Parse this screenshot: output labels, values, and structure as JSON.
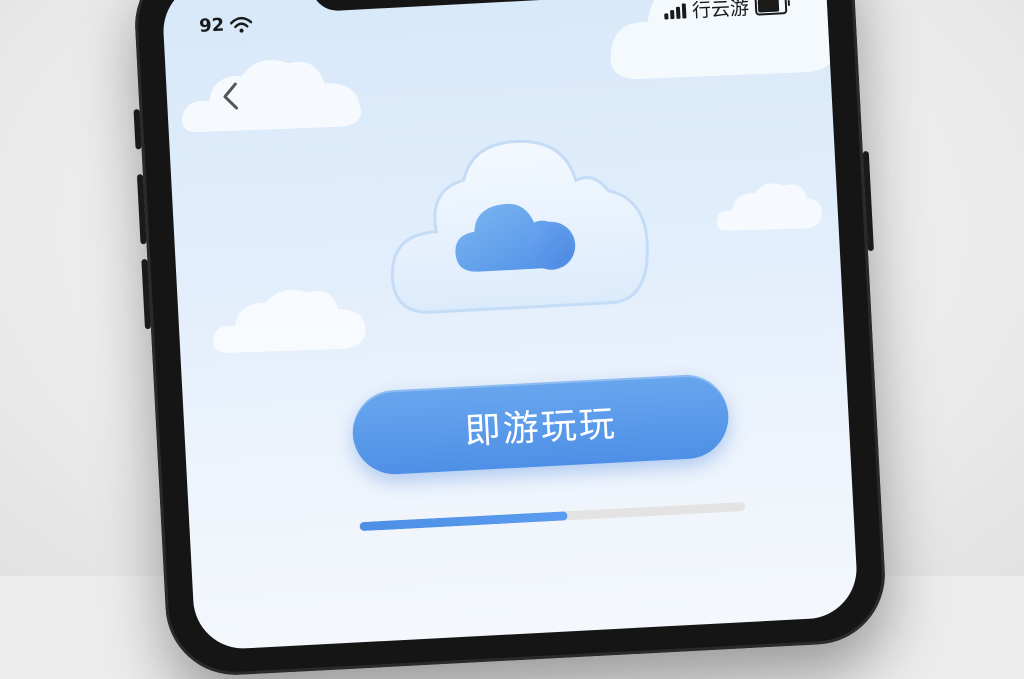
{
  "status_bar": {
    "time": "92",
    "carrier": "行云游"
  },
  "nav": {
    "back_icon": "chevron-left-icon"
  },
  "hero": {
    "icon": "cloud-icon"
  },
  "cta": {
    "label": "即游玩玩"
  },
  "progress": {
    "value": 0.54
  },
  "colors": {
    "accent": "#5596ea",
    "background_top": "#d7e8fa",
    "background_bottom": "#f4f8fd",
    "progress_track": "#e3e3e3"
  }
}
